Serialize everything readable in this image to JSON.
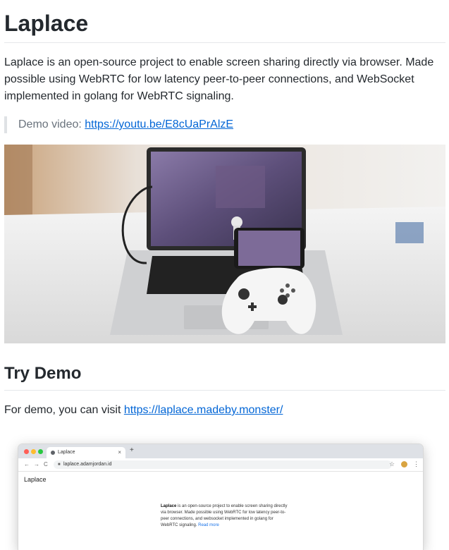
{
  "title": "Laplace",
  "intro": "Laplace is an open-source project to enable screen sharing directly via browser. Made possible using WebRTC for low latency peer-to-peer connections, and WebSocket implemented in golang for WebRTC signaling.",
  "demo_video": {
    "label": "Demo video: ",
    "link": "https://youtu.be/E8cUaPrAlzE"
  },
  "try_demo": {
    "heading": "Try Demo",
    "text": "For demo, you can visit ",
    "link": "https://laplace.madeby.monster/"
  },
  "browser_screenshot": {
    "tab_title": "Laplace",
    "tab_close": "×",
    "new_tab": "+",
    "back": "←",
    "forward": "→",
    "reload": "C",
    "url": "laplace.adamjordan.id",
    "star": "☆",
    "menu": "⋮",
    "page_heading": "Laplace",
    "page_desc_bold": "Laplace",
    "page_desc": " is an open-source project to enable screen sharing directly via browser. Made possible using WebRTC for low latency peer-to-peer connections, and websocket implemented in golang for WebRTC signaling. ",
    "read_more": "Read more"
  },
  "colors": {
    "link": "#0366d6",
    "close_dot": "#ff5f57",
    "minimize_dot": "#febc2e",
    "maximize_dot": "#28c840"
  },
  "icons": [
    "lock-icon",
    "star-icon",
    "avatar-icon",
    "menu-icon",
    "back-arrow-icon",
    "forward-arrow-icon",
    "reload-icon"
  ]
}
